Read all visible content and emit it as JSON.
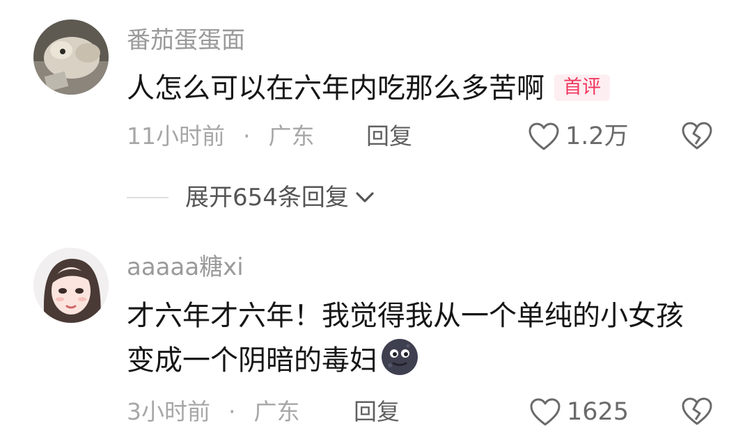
{
  "comments": [
    {
      "username": "番茄蛋蛋面",
      "text": "人怎么可以在六年内吃那么多苦啊",
      "badge": "首评",
      "time": "11小时前",
      "separator": "·",
      "location": "广东",
      "reply_label": "回复",
      "likes": "1.2万",
      "expand_replies": "展开654条回复"
    },
    {
      "username": "aaaaa糖xi",
      "text": "才六年才六年！我觉得我从一个单纯的小女孩变成一个阴暗的毒妇",
      "time": "3小时前",
      "separator": "·",
      "location": "广东",
      "reply_label": "回复",
      "likes": "1625"
    }
  ],
  "icons": {
    "like": "heart-outline-icon",
    "dislike": "broken-heart-icon",
    "expand": "chevron-down-icon",
    "emoji": "new-moon-face-emoji"
  },
  "colors": {
    "badge_text": "#f0375f",
    "badge_bg": "#fdeef1",
    "meta_text": "#a7a7a7",
    "body_text": "#161616"
  }
}
